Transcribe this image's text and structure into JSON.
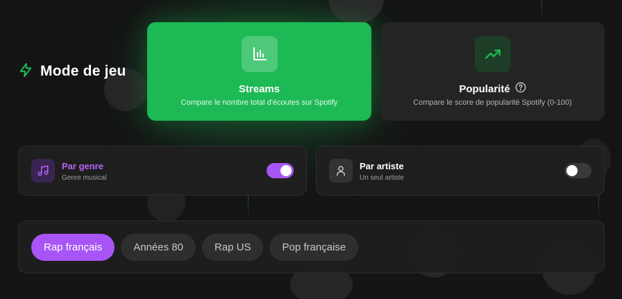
{
  "header": {
    "title": "Mode de jeu",
    "icon": "lightning-icon"
  },
  "modes": [
    {
      "name": "Streams",
      "description": "Compare le nombre total d'écoutes sur Spotify",
      "icon": "bar-chart-icon",
      "selected": true
    },
    {
      "name": "Popularité",
      "description": "Compare le score de popularité Spotify (0-100)",
      "icon": "trending-up-icon",
      "help_icon": "help-circle-icon",
      "selected": false
    }
  ],
  "filters": [
    {
      "label": "Par genre",
      "sub": "Genre musical",
      "icon": "music-note-icon",
      "enabled": true
    },
    {
      "label": "Par artiste",
      "sub": "Un seul artiste",
      "icon": "user-icon",
      "enabled": false
    }
  ],
  "genres": {
    "options": [
      "Rap français",
      "Années 80",
      "Rap US",
      "Pop française"
    ],
    "selected": "Rap français"
  },
  "colors": {
    "green": "#1db954",
    "purple": "#a855f7",
    "background": "#141414"
  }
}
